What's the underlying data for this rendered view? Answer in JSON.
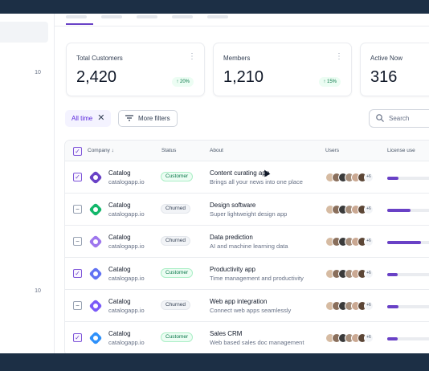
{
  "sidebar": {
    "counts": [
      "10",
      "10"
    ]
  },
  "cards": [
    {
      "label": "Total Customers",
      "value": "2,420",
      "change": "20%"
    },
    {
      "label": "Members",
      "value": "1,210",
      "change": "15%"
    },
    {
      "label": "Active Now",
      "value": "316"
    }
  ],
  "filters": {
    "chip_label": "All time",
    "more_label": "More filters"
  },
  "search": {
    "placeholder": "Search"
  },
  "table": {
    "headers": {
      "company": "Company",
      "status": "Status",
      "about": "About",
      "users": "Users",
      "license": "License use"
    },
    "more_users": "+6",
    "rows": [
      {
        "name": "Catalog",
        "site": "catalogapp.io",
        "status": "Customer",
        "about_title": "Content curating app",
        "about_sub": "Brings all your news into one place",
        "checked": true,
        "logo_color": "#6941c6",
        "license": 0.18
      },
      {
        "name": "Catalog",
        "site": "catalogapp.io",
        "status": "Churned",
        "about_title": "Design software",
        "about_sub": "Super lightweight design app",
        "checked": false,
        "logo_color": "#12b76a",
        "license": 0.36
      },
      {
        "name": "Catalog",
        "site": "catalogapp.io",
        "status": "Churned",
        "about_title": "Data prediction",
        "about_sub": "AI and machine learning data",
        "checked": false,
        "logo_color": "#9e77ed",
        "license": 0.52
      },
      {
        "name": "Catalog",
        "site": "catalogapp.io",
        "status": "Customer",
        "about_title": "Productivity app",
        "about_sub": "Time management and productivity",
        "checked": true,
        "logo_color": "#6172f3",
        "license": 0.16
      },
      {
        "name": "Catalog",
        "site": "catalogapp.io",
        "status": "Churned",
        "about_title": "Web app integration",
        "about_sub": "Connect web apps seamlessly",
        "checked": false,
        "logo_color": "#7a5af8",
        "license": 0.17
      },
      {
        "name": "Catalog",
        "site": "catalogapp.io",
        "status": "Customer",
        "about_title": "Sales CRM",
        "about_sub": "Web based sales doc management",
        "checked": true,
        "logo_color": "#2e90fa",
        "license": 0.16
      }
    ]
  },
  "icons": {
    "dots": "more-vertical-icon",
    "arrow": "arrow-up-icon",
    "close": "close-icon",
    "filter": "filter-lines-icon",
    "search": "search-icon",
    "sort": "arrow-down-icon"
  }
}
